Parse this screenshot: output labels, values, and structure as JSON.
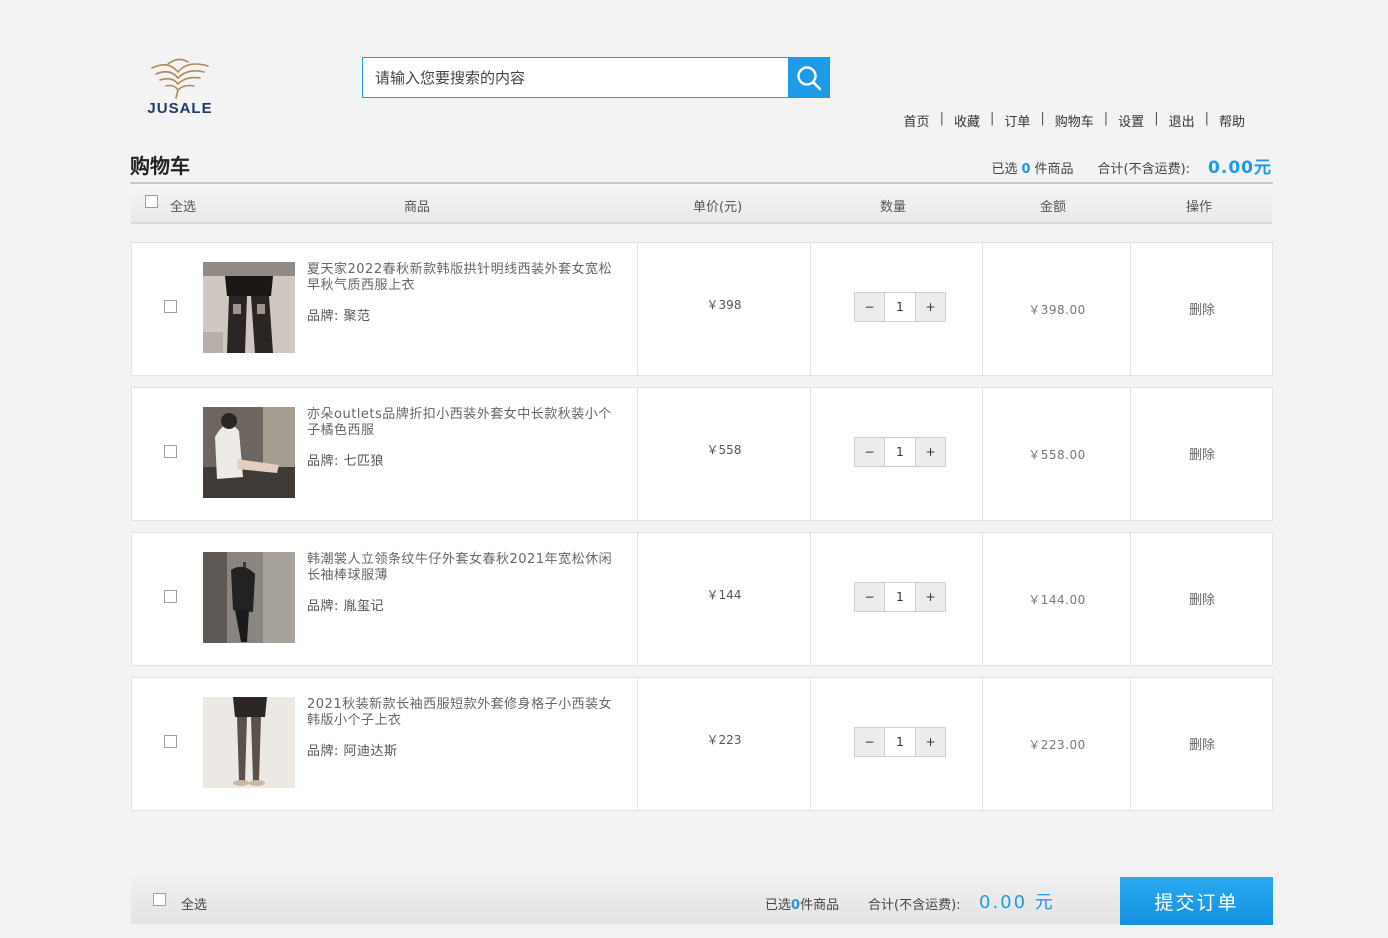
{
  "brand": {
    "logo_text": "JUSALE"
  },
  "search": {
    "placeholder": "请输入您要搜索的内容"
  },
  "nav": {
    "items": [
      "首页",
      "收藏",
      "订单",
      "购物车",
      "设置",
      "退出",
      "帮助"
    ]
  },
  "page": {
    "title": "购物车"
  },
  "summary": {
    "selected_prefix": "已选",
    "selected_count": "0",
    "selected_suffix": "件商品",
    "total_label": "合计(不含运费):",
    "total_value": "0.00元"
  },
  "table": {
    "select_all": "全选",
    "columns": {
      "product": "商品",
      "unit_price": "单价(元)",
      "quantity": "数量",
      "amount": "金额",
      "action": "操作"
    }
  },
  "items": [
    {
      "name": "夏天家2022春秋新款韩版拱针明线西装外套女宽松早秋气质西服上衣",
      "brand_label": "品牌:",
      "brand": "聚范",
      "price": "￥398",
      "quantity": "1",
      "amount": "￥398.00",
      "action": "删除"
    },
    {
      "name": "亦朵outlets品牌折扣小西装外套女中长款秋装小个子橘色西服",
      "brand_label": "品牌:",
      "brand": "七匹狼",
      "price": "￥558",
      "quantity": "1",
      "amount": "￥558.00",
      "action": "删除"
    },
    {
      "name": "韩潮裳人立领条纹牛仔外套女春秋2021年宽松休闲长袖棒球服薄",
      "brand_label": "品牌:",
      "brand": "胤玺记",
      "price": "￥144",
      "quantity": "1",
      "amount": "￥144.00",
      "action": "删除"
    },
    {
      "name": "2021秋装新款长袖西服短款外套修身格子小西装女韩版小个子上衣",
      "brand_label": "品牌:",
      "brand": "阿迪达斯",
      "price": "￥223",
      "quantity": "1",
      "amount": "￥223.00",
      "action": "删除"
    }
  ],
  "qty_controls": {
    "minus": "−",
    "plus": "+"
  },
  "footer": {
    "select_all": "全选",
    "selected_prefix": "已选",
    "selected_count": "0",
    "selected_suffix": "件商品",
    "total_label": "合计(不含运费):",
    "total_value": "0.00 元",
    "submit": "提交订单"
  },
  "colors": {
    "accent": "#1e9be6"
  }
}
